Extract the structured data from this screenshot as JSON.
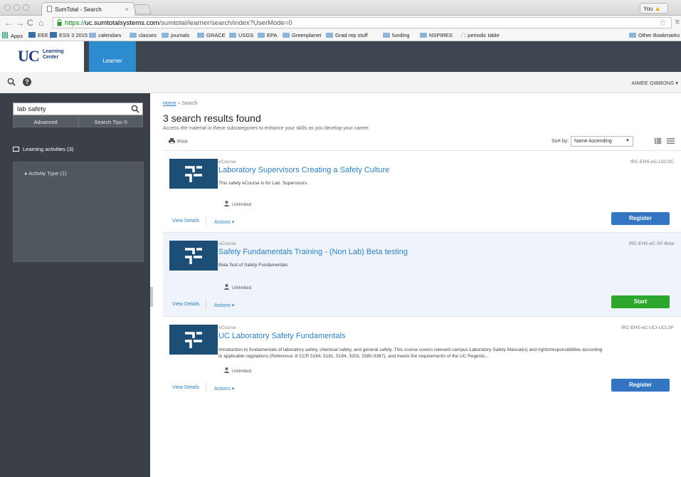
{
  "browser": {
    "tab_title": "SumTotal - Search",
    "tab_close": "×",
    "profile": "You",
    "profile_warning": "▲",
    "url_scheme": "https://",
    "url_host": "uc.sumtotalsystems.com",
    "url_path": "/sumtotal/learner/search/index?UserMode=0",
    "bookmarks": [
      "Apps",
      "EEE",
      "ESS 3 2015",
      "calendars",
      "classes",
      "journals",
      "GRACE",
      "USGS",
      "EPA",
      "Greenplanet",
      "Grad rep stuff",
      "funding",
      "NSPIRES",
      "periodic table",
      "Other Bookmarks"
    ]
  },
  "header": {
    "logo_main": "UC",
    "logo_line1": "Learning",
    "logo_line2": "Center",
    "learner_tab": "Learner",
    "help_glyph": "?",
    "user_name": "AIMEE GIBBONS"
  },
  "sidebar": {
    "search_value": "lab safety",
    "advanced": "Advanced",
    "search_tips": "Search Tips ⍉",
    "learning_activities": "Learning activities (3)",
    "filter_item": "▸  Activity Type (1)"
  },
  "main": {
    "breadcrumb_home": "Home",
    "breadcrumb_sep": "»",
    "breadcrumb_current": "Search",
    "results_title": "3 search results found",
    "results_subtitle": "Access the material in these subcategories to enhance your skills as you develop your career.",
    "print": "Print",
    "sort_label": "Sort by:",
    "sort_value": "Name Ascending"
  },
  "results": [
    {
      "type": "eCourse",
      "title": "Laboratory Supervisors Creating a Safety Culture",
      "description": "This safety eCourse is for Lab. Supervisors.",
      "code": "IRC-EHS-eC-LSCSC",
      "limit": "Unlimited",
      "view_details": "View Details",
      "actions": "Actions ▾",
      "button": "Register"
    },
    {
      "type": "eCourse",
      "title": "Safety Fundamentals Training - (Non Lab) Beta testing",
      "description": "Beta Test of Safety Fundamentals",
      "code": "IRC-EHS-eC-SF-Beta",
      "limit": "Unlimited",
      "view_details": "View Details",
      "actions": "Actions ▾",
      "button": "Start"
    },
    {
      "type": "eCourse",
      "title": "UC Laboratory Safety Fundamentals",
      "description": "Introduction to fundamentals of laboratory safety, chemical safety, and general safety. This course covers relevant campus Laboratory Safety Manual(s) and rights/responsibilities according to applicable regulations (Reference: 8 CCR 5164, 5191, 5194, 3203, 3380-3387), and meets the requirements of the UC Regents...",
      "code": "IRC-EHS-eC-UCI-UCLSF",
      "limit": "Unlimited",
      "view_details": "View Details",
      "actions": "Actions ▾",
      "button": "Register"
    }
  ],
  "colors": {
    "header_bg": "#3c4550",
    "learner_tab": "#2d8ccd",
    "sidebar_bg": "#3a4046",
    "link": "#2d7ec2",
    "register": "#3375c2",
    "start": "#2ca72c",
    "thumb": "#1d4f76"
  }
}
